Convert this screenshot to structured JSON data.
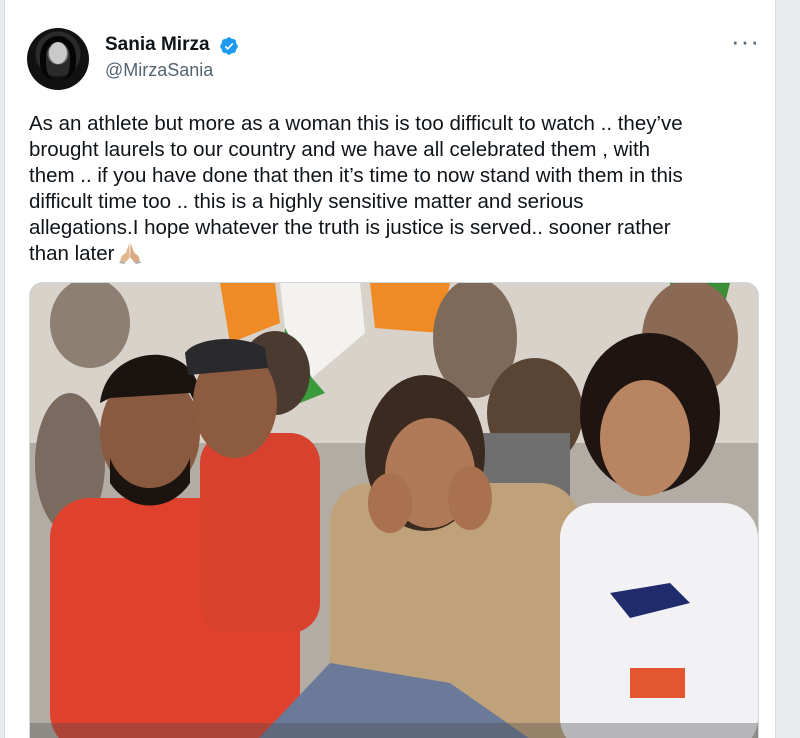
{
  "tweet": {
    "author_name": "Sania Mirza",
    "author_handle": "@MirzaSania",
    "more_label": "···",
    "text": "As an athlete but more as a woman this is too difficult to watch .. they’ve\nbrought laurels to our country and we have all celebrated them , with\nthem .. if you have done that then it’s time to now stand with them in this\ndifficult time too .. this is a highly sensitive matter and serious\nallegations.I hope whatever the truth is justice is served.. sooner rather\nthan later"
  },
  "icons": {
    "verified": "verified-badge-icon",
    "more": "more-options-icon",
    "emoji": "folded-hands-emoji"
  },
  "colors": {
    "verified": "#1d9bf0",
    "text": "#0f1419",
    "secondary": "#536471"
  }
}
